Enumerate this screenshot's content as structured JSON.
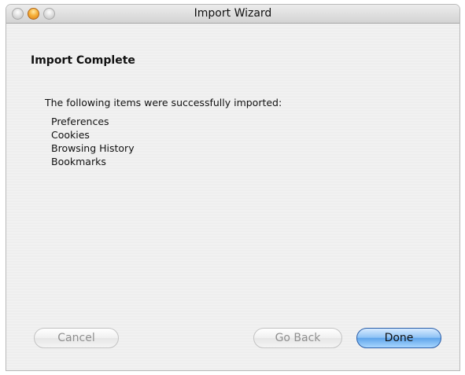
{
  "window": {
    "title": "Import Wizard"
  },
  "content": {
    "heading": "Import Complete",
    "intro": "The following items were successfully imported:",
    "items": [
      "Preferences",
      "Cookies",
      "Browsing History",
      "Bookmarks"
    ]
  },
  "buttons": {
    "cancel": "Cancel",
    "go_back": "Go Back",
    "done": "Done"
  },
  "icons": {
    "close": "close-icon",
    "minimize": "minimize-icon",
    "zoom": "zoom-icon"
  },
  "colors": {
    "default_button": "#7fbdf2"
  }
}
